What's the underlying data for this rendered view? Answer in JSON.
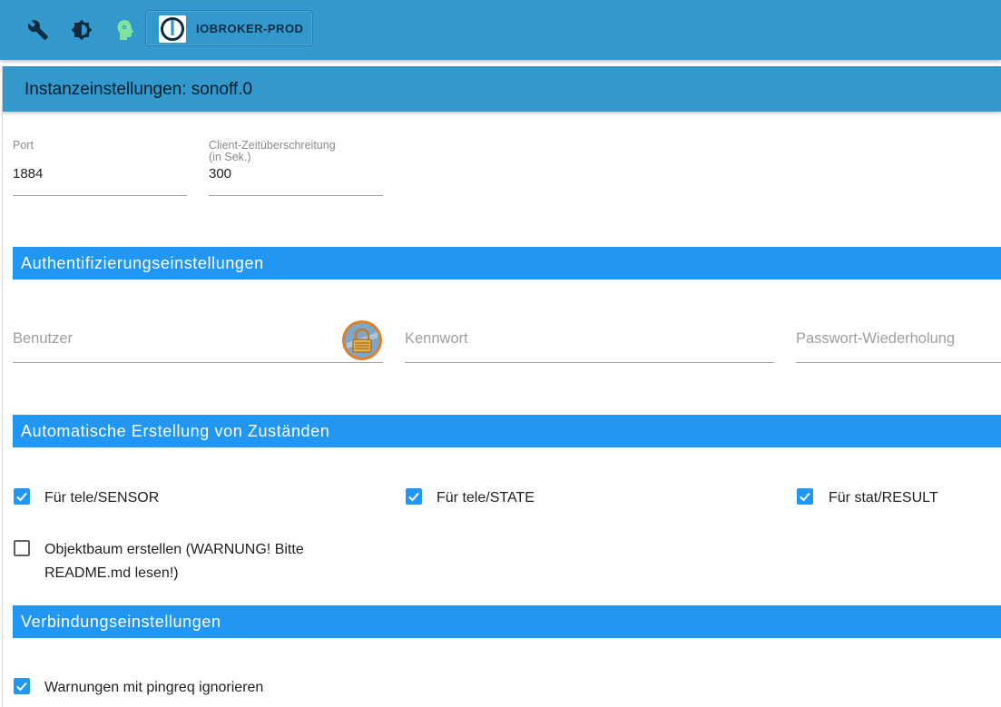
{
  "toolbar": {
    "icons": [
      "wrench-icon",
      "theme-brightness-icon",
      "expert-mode-head-icon"
    ],
    "host_label": "IOBROKER-PROD"
  },
  "title": "Instanzeinstellungen: sonoff.0",
  "connection": {
    "port_label": "Port",
    "port_value": "1884",
    "timeout_label_line1": "Client-Zeitüberschreitung",
    "timeout_label_line2": "(in Sek.)",
    "timeout_value": "300"
  },
  "auth_section": {
    "heading": "Authentifizierungseinstellungen",
    "user_placeholder": "Benutzer",
    "password_placeholder": "Kennwort",
    "password_repeat_placeholder": "Passwort-Wiederholung"
  },
  "states_section": {
    "heading": "Automatische Erstellung von Zuständen",
    "options": [
      {
        "label": "Für tele/SENSOR",
        "checked": true
      },
      {
        "label": "Für tele/STATE",
        "checked": true
      },
      {
        "label": "Für stat/RESULT",
        "checked": true
      }
    ],
    "object_tree_line1": "Objektbaum erstellen (WARNUNG! Bitte",
    "object_tree_line2": "README.md lesen!)",
    "object_tree_checked": false
  },
  "connection_section": {
    "heading": "Verbindungseinstellungen",
    "ignore_ping_label": "Warnungen mit pingreq ignorieren",
    "ignore_ping_checked": true
  },
  "colors": {
    "topbar": "#3399cc",
    "section": "#2196f3",
    "checkbox": "#2196f3",
    "expert_icon": "#7fe3a0"
  }
}
